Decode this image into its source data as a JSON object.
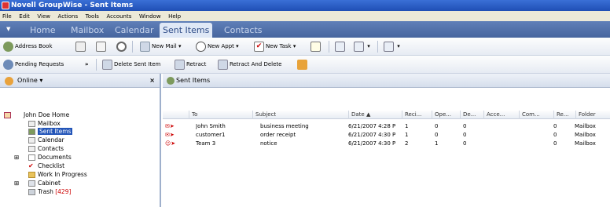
{
  "window": {
    "title": "Novell GroupWise - Sent Items"
  },
  "menu": [
    "File",
    "Edit",
    "View",
    "Actions",
    "Tools",
    "Accounts",
    "Window",
    "Help"
  ],
  "tabs": [
    "Home",
    "Mailbox",
    "Calendar",
    "Sent Items",
    "Contacts"
  ],
  "toolbar1": {
    "address_book": "Address Book",
    "new_mail": "New Mail",
    "new_appt": "New Appt",
    "new_task": "New Task"
  },
  "toolbar2": {
    "pending": "Pending Requests",
    "delete_sent": "Delete Sent Item",
    "retract": "Retract",
    "retract_delete": "Retract And Delete"
  },
  "left": {
    "status": "Online",
    "close": "×",
    "tree": [
      "John Doe  Home",
      "Mailbox",
      "Sent Items",
      "Calendar",
      "Contacts",
      "Documents",
      "Checklist",
      "Work In Progress",
      "Cabinet",
      "Trash"
    ],
    "trash_count": "[429]"
  },
  "right": {
    "title": "Sent Items",
    "columns": [
      "To",
      "Subject",
      "Date",
      "Reci...",
      "Ope...",
      "De...",
      "Acce...",
      "Com...",
      "Re...",
      "Folder"
    ],
    "rows": [
      [
        "John Smith",
        "business meeting",
        "6/21/2007 4:28 P",
        "1",
        "0",
        "0",
        "",
        "",
        "0",
        "Mailbox"
      ],
      [
        "customer1",
        "order receipt",
        "6/21/2007 4:30 P",
        "1",
        "0",
        "0",
        "",
        "",
        "0",
        "Mailbox"
      ],
      [
        "Team 3",
        "notice",
        "6/21/2007 4:30 P",
        "2",
        "1",
        "0",
        "",
        "",
        "0",
        "Mailbox"
      ]
    ]
  },
  "colors": {
    "titlebar": "#2a5ec6",
    "tabbar": "#5171ab",
    "selection": "#2355b8"
  }
}
